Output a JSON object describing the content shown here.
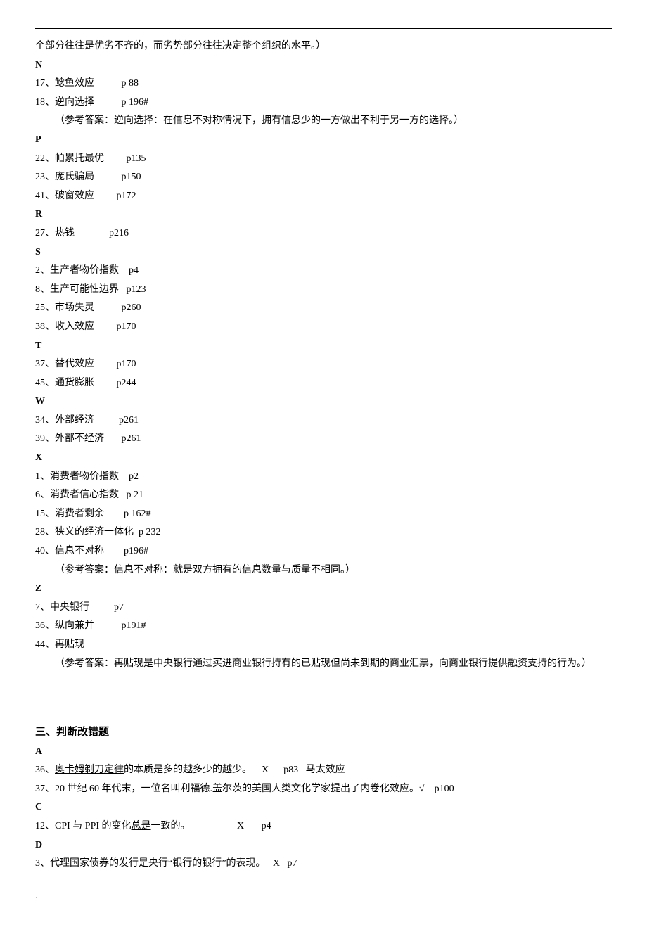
{
  "top_continuation": "个部分往往是优劣不齐的，而劣势部分往往决定整个组织的水平。）",
  "groups": [
    {
      "letter": "N",
      "items": [
        {
          "text": "17、鲶鱼效应           p 88"
        },
        {
          "text": "18、逆向选择           p 196#"
        },
        {
          "note": "（参考答案：逆向选择：在信息不对称情况下，拥有信息少的一方做出不利于另一方的选择。）"
        }
      ]
    },
    {
      "letter": "P",
      "items": [
        {
          "text": "22、帕累托最优         p135"
        },
        {
          "text": "23、庞氏骗局           p150"
        },
        {
          "text": "41、破窗效应         p172"
        }
      ]
    },
    {
      "letter": "R",
      "items": [
        {
          "text": "27、热钱              p216"
        }
      ]
    },
    {
      "letter": "S",
      "items": [
        {
          "text": "2、生产者物价指数    p4"
        },
        {
          "text": "8、生产可能性边界   p123"
        },
        {
          "text": "25、市场失灵           p260"
        },
        {
          "text": "38、收入效应         p170"
        }
      ]
    },
    {
      "letter": "T",
      "items": [
        {
          "text": "37、替代效应         p170"
        },
        {
          "text": "45、通货膨胀         p244"
        }
      ]
    },
    {
      "letter": "W",
      "items": [
        {
          "text": "34、外部经济          p261"
        },
        {
          "text": "39、外部不经济       p261"
        }
      ]
    },
    {
      "letter": "X",
      "items": [
        {
          "text": "1、消费者物价指数    p2"
        },
        {
          "text": "6、消费者信心指数   p 21"
        },
        {
          "text": "15、消费者剩余        p 162#"
        },
        {
          "text": "28、狭义的经济一体化  p 232"
        },
        {
          "text": "40、信息不对称        p196#"
        },
        {
          "note": "（参考答案：信息不对称：就是双方拥有的信息数量与质量不相同。）"
        }
      ]
    },
    {
      "letter": "Z",
      "items": [
        {
          "text": "7、中央银行          p7"
        },
        {
          "text": "36、纵向兼并           p191#"
        },
        {
          "text": "44、再贴现"
        },
        {
          "note": "（参考答案：再贴现是中央银行通过买进商业银行持有的已贴现但尚未到期的商业汇票，向商业银行提供融资支持的行为。）"
        }
      ]
    }
  ],
  "section3_title": "三、判断改错题",
  "judge_groups": [
    {
      "letter": "A",
      "items": [
        {
          "pre": "36、",
          "u": "奥卡姆剃刀定律",
          "post": "的本质是多的越多少的越少。    X      p83   马太效应"
        },
        {
          "pre": "37、20 世纪 60 年代末，一位名叫利福德.盖尔茨的美国人类文化学家提出了内卷化效应。√    p100",
          "u": "",
          "post": ""
        }
      ]
    },
    {
      "letter": "C",
      "items": [
        {
          "pre": "12、CPI 与 PPI 的变化",
          "u": "总是",
          "post": "一致的。                   X       p4"
        }
      ]
    },
    {
      "letter": "D",
      "items": [
        {
          "pre": "3、代理国家债券的发行是央行",
          "u": "“银行的银行”",
          "post": "的表现。   X   p7"
        }
      ]
    }
  ],
  "footer": "."
}
